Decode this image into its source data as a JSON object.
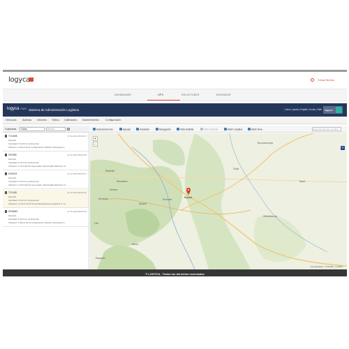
{
  "brand": {
    "logo": "logyca",
    "user_link": "Cesar Muñoz"
  },
  "tabs": [
    {
      "label": "DASHBOARD"
    },
    {
      "label": "GPS"
    },
    {
      "label": "SOLICITUDES"
    },
    {
      "label": "TAXIEADOR"
    }
  ],
  "app": {
    "logo_main": "logyca",
    "logo_sub": "CMS",
    "title": "Sistema de Administración Logística",
    "links": "| Inicio | Ayuda | English | Invías | Salir",
    "badge": "logyca"
  },
  "menu": [
    "Vehículos",
    "Alarmas",
    "Informes",
    "Tráfico",
    "Calificación",
    "Mantenimiento",
    "Configuración"
  ],
  "filter": {
    "label": "Columnas",
    "select_value": "Todas",
    "search_placeholder": "Buscar"
  },
  "vehicles": [
    {
      "name": "TCU658",
      "date": "27-11-2019 09:23:17",
      "l1": "Detenido",
      "l2": "Velocidad: 0 Km/h Km de Dirección",
      "l3": "Ubicación: cl 9bis # 20-42 La Esperanza, Medellín (Antioquia) Co"
    },
    {
      "name": "FAT856",
      "date": "27-11-2019 09:21:50",
      "l1": "Detenido",
      "l2": "Velocidad: 0 Km/h Km de Dirección",
      "l3": "Ubicación: cl 19 # 18a-34 Jorge Gaitán, Barranquilla (Atlántico) Co"
    },
    {
      "name": "NVA024",
      "date": "27-11-2019 09:22:17",
      "l1": "Detenido",
      "l2": "Velocidad: 0 Km/h Km de Dirección",
      "l3": "Ubicación: cl 19 # 18a-34 Jorge Gaitán, Barranquilla (Atlántico) Co"
    },
    {
      "name": "TCJ438",
      "date": "27-11-2019 09:20:41",
      "l1": "Detenido",
      "l2": "Velocidad: 0 Km/h Km de Dirección",
      "l3": "Ubicación: cra 34 # 23-18 Comunidad Esperanza, Bogotá D.C. Co"
    },
    {
      "name": "SPM683",
      "date": "27-11-2019 09:20:22",
      "l1": "Detenido",
      "l2": "Velocidad: 0 Km/h Km de Dirección",
      "l3": "Ubicación: cl 9bis # 20-42 La Esperanza, Medellín (Antioquia) Co"
    }
  ],
  "toolbar": {
    "buttons": [
      "Seleccionar todo",
      "Agrupar",
      "Actualizar",
      "Navegación",
      "Vista Satelital",
      "Vista Vectorial",
      "Medir Longitud",
      "Medir Área"
    ],
    "search_placeholder": "Encontrar dirección, Ciudad"
  },
  "map": {
    "labels": [
      "Medellín",
      "Manizales",
      "Pereira",
      "Ibagué",
      "Tunja",
      "Bogotá",
      "Villavicencio",
      "Neiva",
      "Girardot",
      "Bucaramanga",
      "Yopal",
      "Armenia",
      "Cali",
      "Popayán"
    ],
    "pin_label": "Bogotá",
    "coords": "Coordenadas: -72.51355 , 4.13307"
  },
  "footer": "© LOGYCA - Todos los derechos reservados"
}
